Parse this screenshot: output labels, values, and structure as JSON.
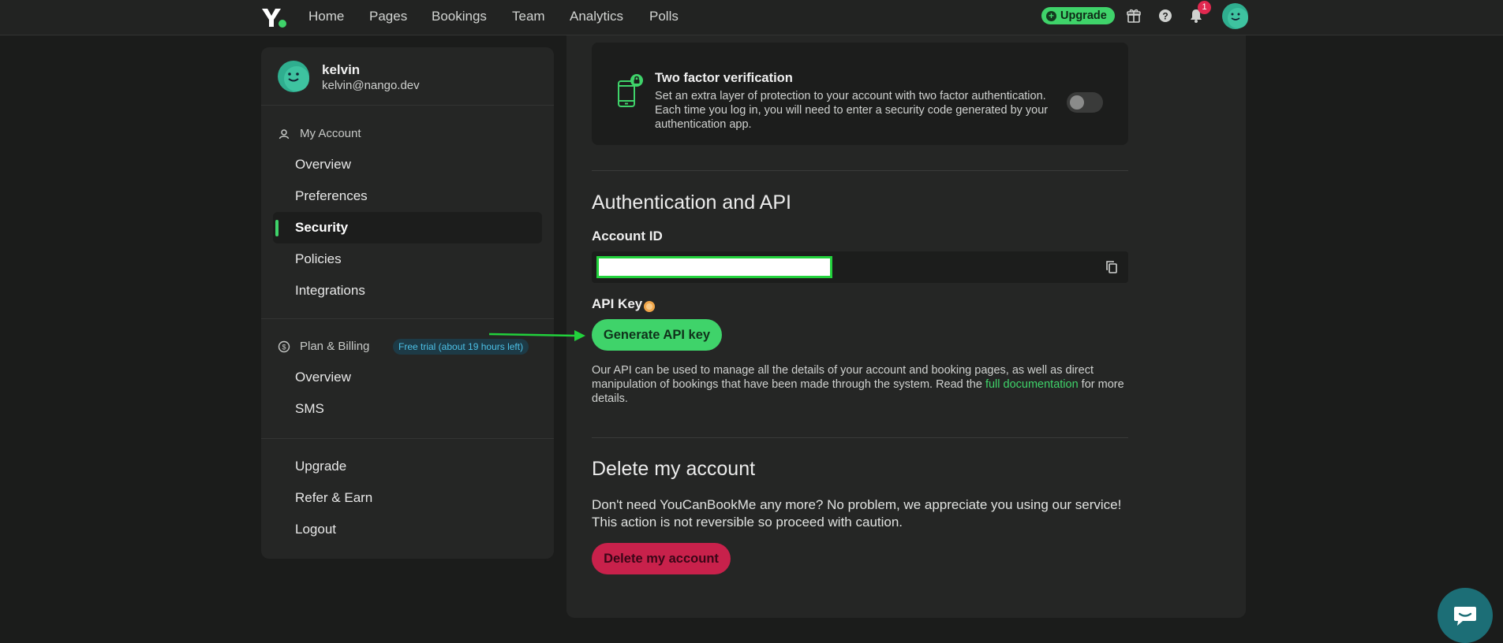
{
  "nav": {
    "links": [
      "Home",
      "Pages",
      "Bookings",
      "Team",
      "Analytics",
      "Polls"
    ],
    "upgrade_label": "Upgrade",
    "notification_count": "1",
    "icons": [
      "gift-icon",
      "help-icon",
      "bell-icon",
      "avatar"
    ]
  },
  "sidebar": {
    "user": {
      "name": "kelvin",
      "email": "kelvin@nango.dev"
    },
    "my_account": {
      "heading": "My Account",
      "items": [
        {
          "label": "Overview",
          "active": false
        },
        {
          "label": "Preferences",
          "active": false
        },
        {
          "label": "Security",
          "active": true
        },
        {
          "label": "Policies",
          "active": false
        },
        {
          "label": "Integrations",
          "active": false
        }
      ]
    },
    "billing": {
      "heading": "Plan & Billing",
      "badge": "Free trial (about 19 hours left)",
      "items": [
        {
          "label": "Overview"
        },
        {
          "label": "SMS"
        }
      ]
    },
    "footer_items": [
      {
        "label": "Upgrade"
      },
      {
        "label": "Refer & Earn"
      },
      {
        "label": "Logout"
      }
    ]
  },
  "main": {
    "two_factor": {
      "title": "Two factor verification",
      "description": "Set an extra layer of protection to your account with two factor authentication. Each time you log in, you will need to enter a security code generated by your authentication app.",
      "enabled": false
    },
    "auth_api": {
      "heading": "Authentication and API",
      "account_id_label": "Account ID",
      "account_id_value": "",
      "api_key_label": "API Key",
      "generate_button": "Generate API key",
      "desc_before": "Our API can be used to manage all the details of your account and booking pages, as well as direct manipulation of bookings that have been made through the system. Read the ",
      "desc_link": "full documentation",
      "desc_after": " for more details."
    },
    "delete": {
      "heading": "Delete my account",
      "line1": "Don't need YouCanBookMe any more? No problem, we appreciate you using our service!",
      "line2": "This action is not reversible so proceed with caution.",
      "button": "Delete my account"
    }
  },
  "colors": {
    "accent": "#3fd36a",
    "danger": "#c8214b",
    "background": "#1b1c1b",
    "panel": "#252625",
    "badge_bg": "#1d3a46",
    "badge_text": "#4cc0e6",
    "chat": "#1c6e76"
  }
}
